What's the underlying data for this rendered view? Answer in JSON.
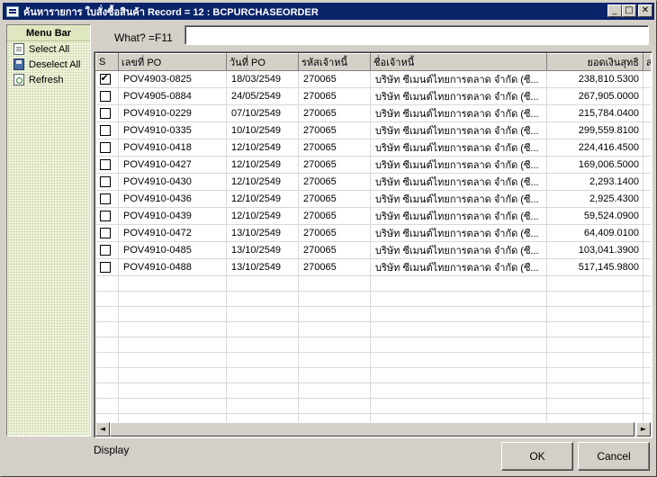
{
  "window": {
    "title": "ค้นหารายการ ใบสั่งซื้อสินค้า Record = 12 : BCPURCHASEORDER",
    "buttons": {
      "minimize": "_",
      "maximize": "□",
      "close": "✕"
    }
  },
  "menu": {
    "title": "Menu Bar",
    "items": [
      {
        "label": "Select All",
        "icon": "document-icon"
      },
      {
        "label": "Deselect All",
        "icon": "floppy-disk-icon"
      },
      {
        "label": "Refresh",
        "icon": "refresh-icon"
      }
    ]
  },
  "search": {
    "label": "What? =F11",
    "value": ""
  },
  "grid": {
    "columns": [
      "S",
      "เลขที่ PO",
      "วันที่ PO",
      "รหัสเจ้าหนี้",
      "ชื่อเจ้าหนี้",
      "ยอดเงินสุทธิ",
      "สถ"
    ],
    "rows": [
      {
        "checked": true,
        "po": "POV4903-0825",
        "date": "18/03/2549",
        "code": "270065",
        "name": "บริษัท ซีเมนต์ไทยการตลาด จำกัด (ซี...",
        "amount": "238,810.5300"
      },
      {
        "checked": false,
        "po": "POV4905-0884",
        "date": "24/05/2549",
        "code": "270065",
        "name": "บริษัท ซีเมนต์ไทยการตลาด จำกัด (ซี...",
        "amount": "267,905.0000"
      },
      {
        "checked": false,
        "po": "POV4910-0229",
        "date": "07/10/2549",
        "code": "270065",
        "name": "บริษัท ซีเมนต์ไทยการตลาด จำกัด (ซี...",
        "amount": "215,784.0400"
      },
      {
        "checked": false,
        "po": "POV4910-0335",
        "date": "10/10/2549",
        "code": "270065",
        "name": "บริษัท ซีเมนต์ไทยการตลาด จำกัด (ซี...",
        "amount": "299,559.8100"
      },
      {
        "checked": false,
        "po": "POV4910-0418",
        "date": "12/10/2549",
        "code": "270065",
        "name": "บริษัท ซีเมนต์ไทยการตลาด จำกัด (ซี...",
        "amount": "224,416.4500"
      },
      {
        "checked": false,
        "po": "POV4910-0427",
        "date": "12/10/2549",
        "code": "270065",
        "name": "บริษัท ซีเมนต์ไทยการตลาด จำกัด (ซี...",
        "amount": "169,006.5000"
      },
      {
        "checked": false,
        "po": "POV4910-0430",
        "date": "12/10/2549",
        "code": "270065",
        "name": "บริษัท ซีเมนต์ไทยการตลาด จำกัด (ซี...",
        "amount": "2,293.1400"
      },
      {
        "checked": false,
        "po": "POV4910-0436",
        "date": "12/10/2549",
        "code": "270065",
        "name": "บริษัท ซีเมนต์ไทยการตลาด จำกัด (ซี...",
        "amount": "2,925.4300"
      },
      {
        "checked": false,
        "po": "POV4910-0439",
        "date": "12/10/2549",
        "code": "270065",
        "name": "บริษัท ซีเมนต์ไทยการตลาด จำกัด (ซี...",
        "amount": "59,524.0900"
      },
      {
        "checked": false,
        "po": "POV4910-0472",
        "date": "13/10/2549",
        "code": "270065",
        "name": "บริษัท ซีเมนต์ไทยการตลาด จำกัด (ซี...",
        "amount": "64,409.0100"
      },
      {
        "checked": false,
        "po": "POV4910-0485",
        "date": "13/10/2549",
        "code": "270065",
        "name": "บริษัท ซีเมนต์ไทยการตลาด จำกัด (ซี...",
        "amount": "103,041.3900"
      },
      {
        "checked": false,
        "po": "POV4910-0488",
        "date": "13/10/2549",
        "code": "270065",
        "name": "บริษัท ซีเมนต์ไทยการตลาด จำกัด (ซี...",
        "amount": "517,145.9800"
      }
    ],
    "scroll_left": "◄",
    "scroll_right": "►"
  },
  "footer": {
    "display_label": "Display",
    "ok_label": "OK",
    "cancel_label": "Cancel"
  }
}
